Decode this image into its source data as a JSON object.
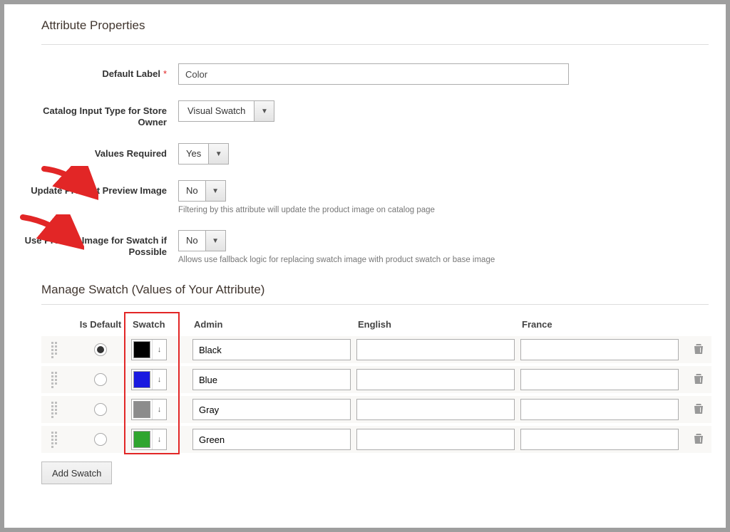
{
  "section1_title": "Attribute Properties",
  "fields": {
    "default_label": {
      "label": "Default Label",
      "value": "Color",
      "required": true
    },
    "catalog_input_type": {
      "label": "Catalog Input Type for Store Owner",
      "value": "Visual Swatch"
    },
    "values_required": {
      "label": "Values Required",
      "value": "Yes"
    },
    "update_preview": {
      "label": "Update Product Preview Image",
      "value": "No",
      "note": "Filtering by this attribute will update the product image on catalog page"
    },
    "use_product_image": {
      "label": "Use Product Image for Swatch if Possible",
      "value": "No",
      "note": "Allows use fallback logic for replacing swatch image with product swatch or base image"
    }
  },
  "section2_title": "Manage Swatch (Values of Your Attribute)",
  "columns": {
    "is_default": "Is Default",
    "swatch": "Swatch",
    "admin": "Admin",
    "english": "English",
    "france": "France"
  },
  "rows": [
    {
      "default": true,
      "color": "#000000",
      "admin": "Black",
      "english": "",
      "france": ""
    },
    {
      "default": false,
      "color": "#1a1ae0",
      "admin": "Blue",
      "english": "",
      "france": ""
    },
    {
      "default": false,
      "color": "#8c8c8c",
      "admin": "Gray",
      "english": "",
      "france": ""
    },
    {
      "default": false,
      "color": "#2fa52f",
      "admin": "Green",
      "english": "",
      "france": ""
    }
  ],
  "add_swatch_label": "Add Swatch"
}
